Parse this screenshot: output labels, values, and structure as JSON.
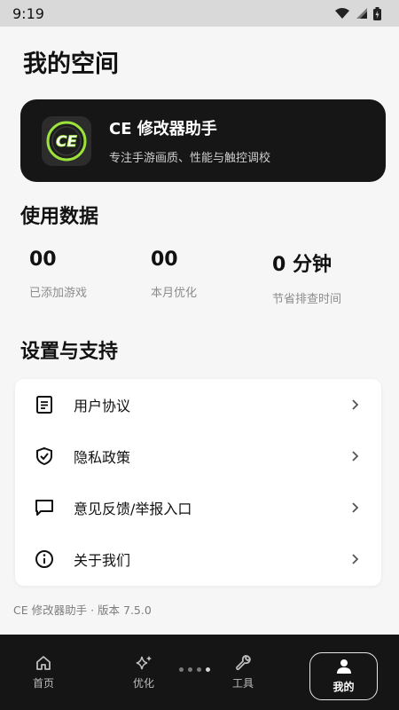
{
  "status": {
    "time": "9:19"
  },
  "page": {
    "title": "我的空间"
  },
  "hero": {
    "title": "CE 修改器助手",
    "subtitle": "专注手游画质、性能与触控调校",
    "logo_text": "CE"
  },
  "usage": {
    "title": "使用数据",
    "stats": [
      {
        "value": "00",
        "label": "已添加游戏"
      },
      {
        "value": "00",
        "label": "本月优化"
      },
      {
        "value": "0 分钟",
        "label": "节省排查时间"
      }
    ]
  },
  "settings": {
    "title": "设置与支持",
    "items": [
      {
        "label": "用户协议",
        "icon": "document-icon"
      },
      {
        "label": "隐私政策",
        "icon": "shield-check-icon"
      },
      {
        "label": "意见反馈/举报入口",
        "icon": "chat-bubble-icon"
      },
      {
        "label": "关于我们",
        "icon": "info-icon"
      }
    ]
  },
  "version": {
    "text": "CE 修改器助手 · 版本 7.5.0"
  },
  "nav": {
    "items": [
      {
        "label": "首页",
        "icon": "home-icon"
      },
      {
        "label": "优化",
        "icon": "sparkle-icon"
      },
      {
        "label": "工具",
        "icon": "wrench-icon"
      },
      {
        "label": "我的",
        "icon": "person-icon",
        "active": true
      }
    ]
  },
  "colors": {
    "dark": "#161616",
    "background": "#f6f6f6",
    "logo_green": "#9be23a"
  }
}
